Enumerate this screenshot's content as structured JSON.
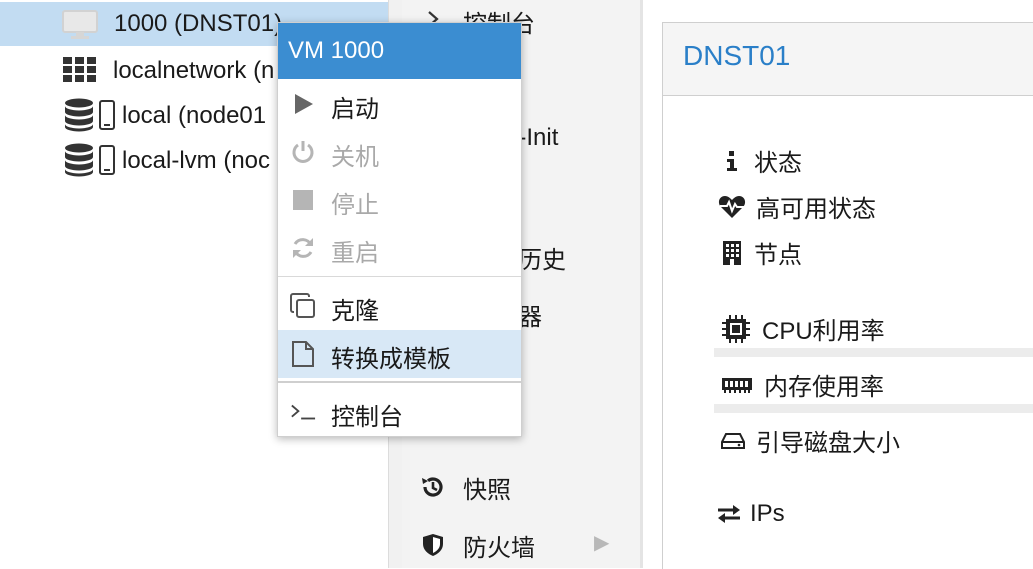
{
  "tree": {
    "items": [
      {
        "label": "1000 (DNST01)",
        "icon": "monitor-icon"
      },
      {
        "label": "localnetwork (n",
        "icon": "grid-icon"
      },
      {
        "label": "local (node01",
        "icon": "storage-icon"
      },
      {
        "label": "local-lvm (noc",
        "icon": "storage-icon"
      }
    ]
  },
  "nav": {
    "items": [
      {
        "label": "控制台",
        "icon": "chevron-right-icon"
      },
      {
        "label": "d-Init",
        "icon": ""
      },
      {
        "label": "历史",
        "icon": ""
      },
      {
        "label": "器",
        "icon": ""
      },
      {
        "label": "快照",
        "icon": "history-icon"
      },
      {
        "label": "防火墙",
        "icon": "shield-icon"
      }
    ]
  },
  "panel": {
    "title": "DNST01",
    "stats": [
      {
        "label": "状态",
        "icon": "info-icon"
      },
      {
        "label": "高可用状态",
        "icon": "heartbeat-icon"
      },
      {
        "label": "节点",
        "icon": "building-icon"
      },
      {
        "label": "CPU利用率",
        "icon": "cpu-icon"
      },
      {
        "label": "内存使用率",
        "icon": "memory-icon"
      },
      {
        "label": "引导磁盘大小",
        "icon": "hdd-icon"
      },
      {
        "label": "IPs",
        "icon": "exchange-icon"
      }
    ]
  },
  "context_menu": {
    "title": "VM 1000",
    "items": [
      {
        "label": "启动",
        "icon": "play-icon",
        "enabled": true
      },
      {
        "label": "关机",
        "icon": "power-icon",
        "enabled": false
      },
      {
        "label": "停止",
        "icon": "stop-icon",
        "enabled": false
      },
      {
        "label": "重启",
        "icon": "refresh-icon",
        "enabled": false
      },
      {
        "label": "克隆",
        "icon": "clone-icon",
        "enabled": true
      },
      {
        "label": "转换成模板",
        "icon": "file-icon",
        "enabled": true,
        "hovered": true
      },
      {
        "label": "控制台",
        "icon": "terminal-icon",
        "enabled": true
      }
    ]
  },
  "colors": {
    "accent": "#3b8dd1",
    "title_blue": "#2a7fc8",
    "selected_row": "#c2dcf2",
    "hover_item": "#d8e8f6",
    "disabled_text": "#a9a9a9"
  }
}
